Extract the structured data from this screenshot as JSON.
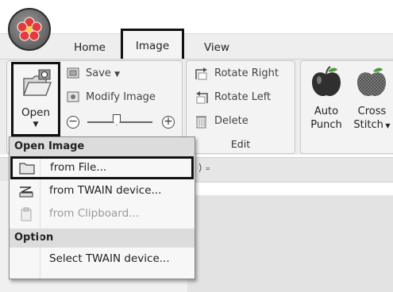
{
  "tabs": [
    {
      "label": "Home"
    },
    {
      "label": "Image"
    },
    {
      "label": "View"
    }
  ],
  "ribbon": {
    "image_group": {
      "open_label": "Open",
      "save_label": "Save",
      "modify_label": "Modify Image"
    },
    "edit_group": {
      "rotate_right": "Rotate Right",
      "rotate_left": "Rotate Left",
      "delete": "Delete",
      "group_label": "Edit"
    },
    "stitch_group": {
      "auto_punch_line1": "Auto",
      "auto_punch_line2": "Punch",
      "cross_stitch_line1": "Cross",
      "cross_stitch_line2": "Stitch"
    }
  },
  "menu": {
    "open_image_header": "Open Image",
    "items": [
      {
        "label": "from File...",
        "enabled": true
      },
      {
        "label": "from TWAIN device...",
        "enabled": true
      },
      {
        "label": "from Clipboard...",
        "enabled": false
      }
    ],
    "option_header": "Option",
    "option_items": [
      {
        "label": "Select TWAIN device..."
      }
    ]
  },
  "colors": {
    "highlight_border": "#111111",
    "disabled_text": "#9a9a9a",
    "apple_green": "#4f9a3a"
  }
}
